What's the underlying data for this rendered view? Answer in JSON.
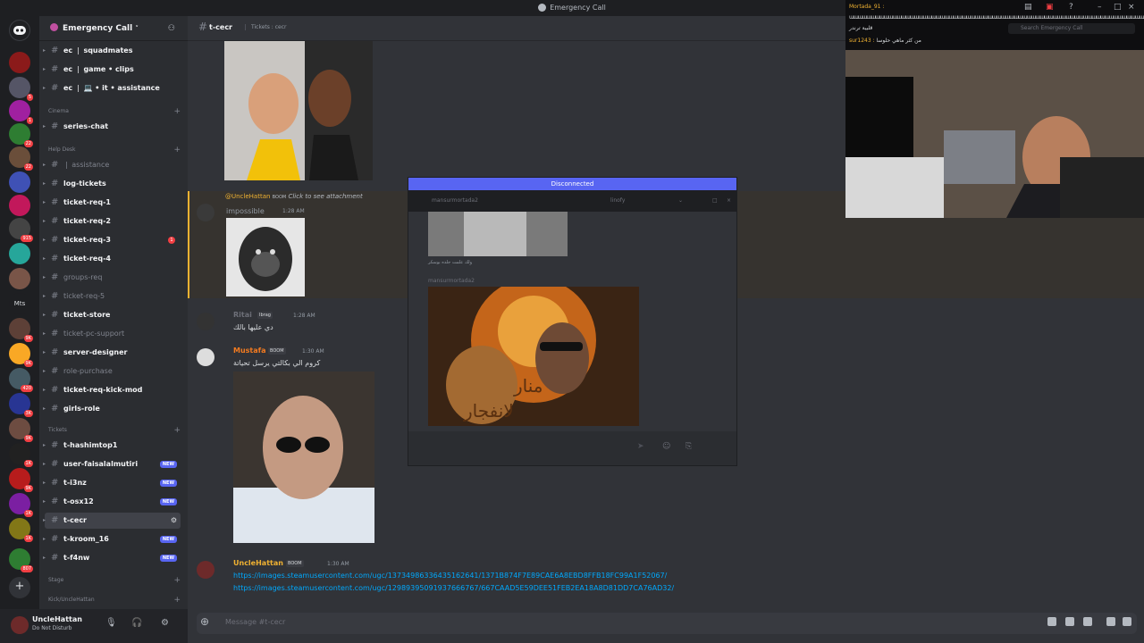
{
  "window": {
    "title": "Emergency Call"
  },
  "server": {
    "name": "Emergency Call"
  },
  "channels": [
    {
      "name": "ec ❘ squadmates",
      "bright": true,
      "arrow": true
    },
    {
      "name": "ec ❘ game • clips",
      "bright": true,
      "arrow": true
    },
    {
      "name": "ec ❘ 💻 • it • assistance",
      "bright": true,
      "arrow": true
    }
  ],
  "categories": {
    "cinema": "Cinema",
    "help_desk": "Help Desk",
    "tickets": "Tickets",
    "stage": "Stage",
    "kick": "Kick/UncleHattan"
  },
  "channels2": [
    {
      "name": "series-chat",
      "bright": true
    },
    {
      "name": "❘ assistance",
      "bright": false
    },
    {
      "name": "log-tickets",
      "bright": true
    },
    {
      "name": "ticket-req-1",
      "bright": true
    },
    {
      "name": "ticket-req-2",
      "bright": true
    },
    {
      "name": "ticket-req-3",
      "bright": true,
      "badge": "1"
    },
    {
      "name": "ticket-req-4",
      "bright": true
    },
    {
      "name": "groups-req",
      "bright": false
    },
    {
      "name": "ticket-req-5",
      "bright": false
    },
    {
      "name": "ticket-store",
      "bright": true
    },
    {
      "name": "ticket-pc-support",
      "bright": false
    },
    {
      "name": "server-designer",
      "bright": true
    },
    {
      "name": "role-purchase",
      "bright": false
    },
    {
      "name": "ticket-req-kick-mod",
      "bright": true
    },
    {
      "name": "girls-role",
      "bright": true
    }
  ],
  "ticket_channels": [
    {
      "name": "t-hashimtop1",
      "bright": true
    },
    {
      "name": "user-faisalalmutiri",
      "bright": true,
      "new": "NEW"
    },
    {
      "name": "t-i3nz",
      "bright": true,
      "new": "NEW"
    },
    {
      "name": "t-osx12",
      "bright": true,
      "new": "NEW"
    },
    {
      "name": "t-cecr",
      "bright": true,
      "active": true
    },
    {
      "name": "t-kroom_16",
      "bright": true,
      "new": "NEW"
    },
    {
      "name": "t-f4nw",
      "bright": true,
      "new": "NEW"
    }
  ],
  "user": {
    "name": "UncleHattan",
    "status": "Do Not Disturb"
  },
  "header": {
    "channel": "t-cecr",
    "topic": "Tickets : cecr"
  },
  "messages": {
    "reply_author": "@UncleHattan",
    "reply_tag": "BOOM",
    "reply_text": "Click to see attachment",
    "m1_author": "impossible",
    "m1_time": "1:28 AM",
    "m2_author": "Ritai",
    "m2_tag": "Ibrag",
    "m2_time": "1:28 AM",
    "m2_text": "دي عليها بالك",
    "m3_author": "Mustafa",
    "m3_tag": "BOOM",
    "m3_time": "1:30 AM",
    "m3_text": "كروم الي بكالتي يرسل تحياتة",
    "m4_author": "UncleHattan",
    "m4_tag": "BOOM",
    "m4_time": "1:30 AM",
    "m4_link1": "https://images.steamusercontent.com/ugc/1373498633643516264​1/1371B874F7E89CAE6A8EBD8FFB18FC99A1F52067/",
    "m4_link2": "https://images.steamusercontent.com/ugc/1298939509193766676​7/667CAAD5E59DEE51FEB2EA18A8D81DD7CA76AD32/"
  },
  "composer": {
    "placeholder": "Message #t-cecr"
  },
  "popup": {
    "status": "Disconnected",
    "tab1": "mansurmortada2",
    "tab2": "linofy",
    "caption1": "ولك علمت جلده بوسكر",
    "author": "mansurmortada2",
    "img_text1": "منار",
    "img_text2": "لانفجار"
  },
  "stream": {
    "chat1_user": "Mortada_91 :",
    "chat2": "قلبية ترندر",
    "chat3_user": "sur1243 :",
    "chat3_text": "من كثر ماهي حلوسا"
  },
  "search": {
    "placeholder": "Search Emergency Call"
  },
  "colors": {
    "accent": "#5865f2",
    "gold": "#f0b232",
    "orange": "#f47b20",
    "link": "#00a8fc"
  }
}
